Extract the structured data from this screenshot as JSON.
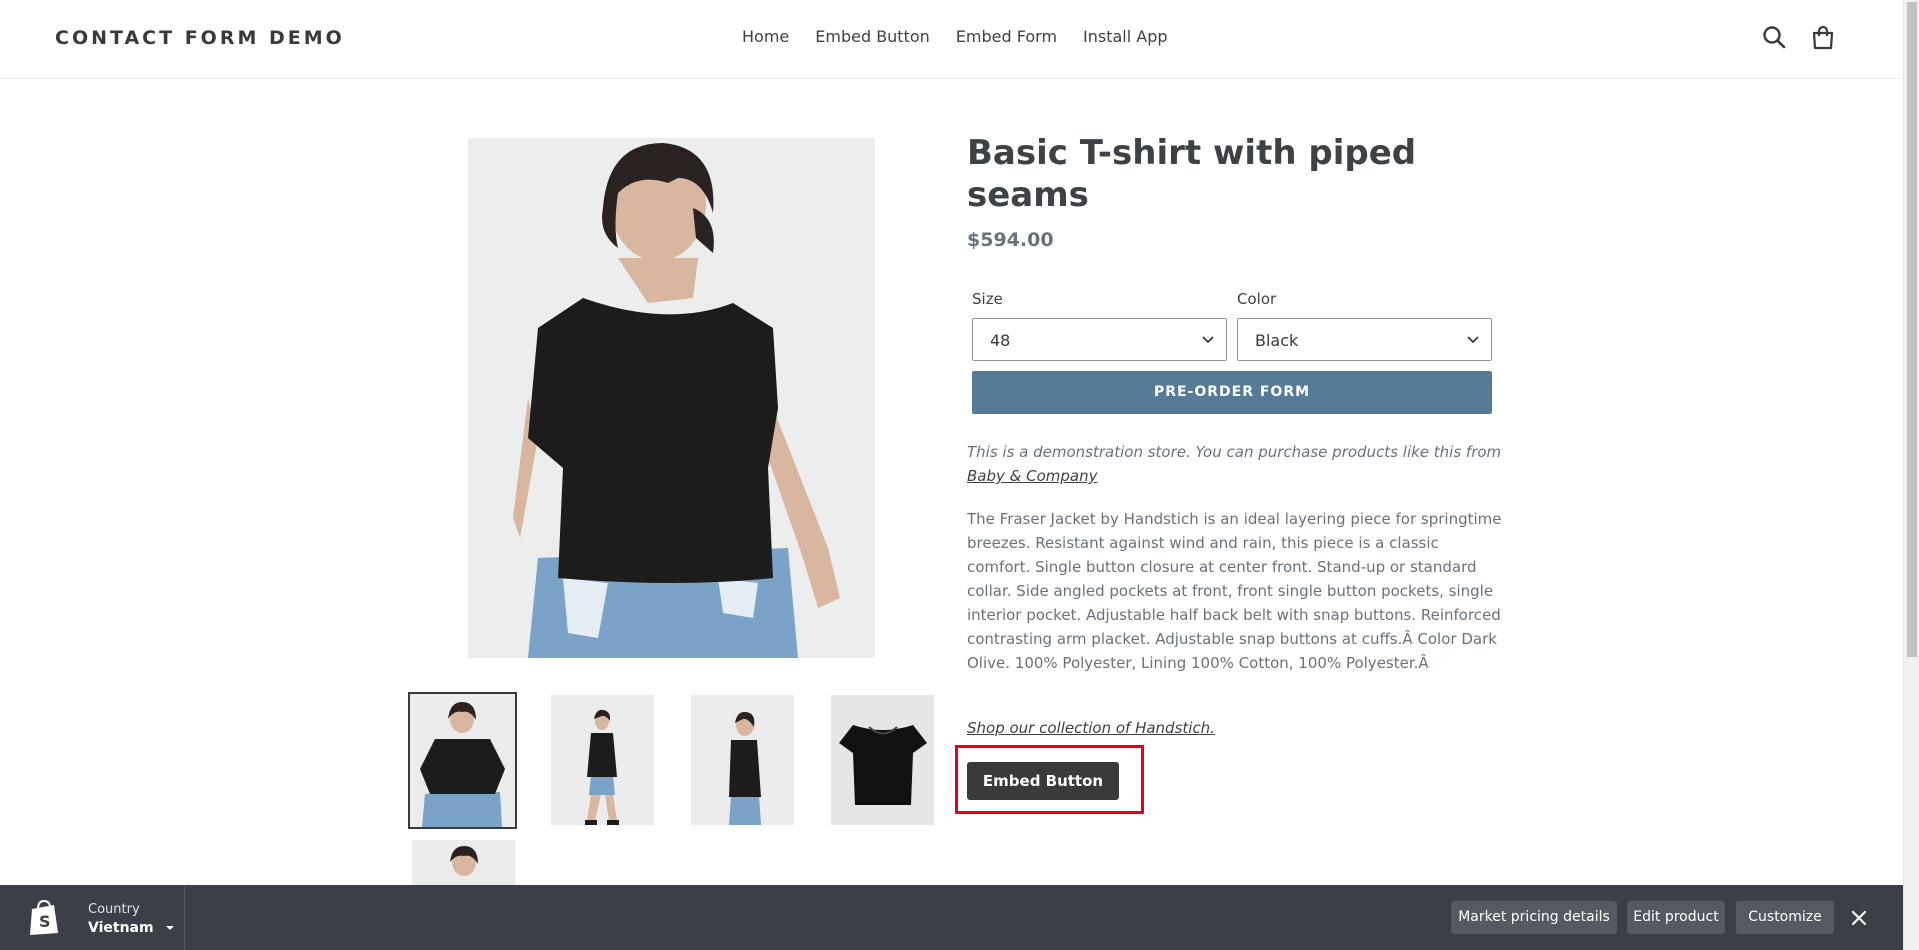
{
  "header": {
    "logo": "CONTACT FORM DEMO",
    "nav": [
      "Home",
      "Embed Button",
      "Embed Form",
      "Install App"
    ],
    "search_icon": "search-icon",
    "cart_icon": "cart-icon"
  },
  "product": {
    "title": "Basic T-shirt with piped seams",
    "price": "$594.00",
    "size_label": "Size",
    "size_value": "48",
    "color_label": "Color",
    "color_value": "Black",
    "preorder_label": "PRE-ORDER FORM",
    "demo_note": "This is a demonstration store. You can purchase products like this from",
    "demo_link": "Baby & Company",
    "description": "The Fraser Jacket by Handstich is an ideal layering piece for springtime breezes. Resistant against wind and rain, this piece is a classic comfort. Single button closure at center front. Stand-up or standard collar. Side angled pockets at front, front single button pockets, single interior pocket. Adjustable half back belt with snap buttons. Reinforced contrasting arm placket. Adjustable snap buttons at cuffs.Â Color Dark Olive. 100% Polyester, Lining 100% Cotton, 100% Polyester.Â",
    "shop_link": "Shop our collection of Handstich.",
    "embed_button": "Embed Button"
  },
  "admin_bar": {
    "country_label": "Country",
    "country_value": "Vietnam",
    "buttons": [
      "Market pricing details",
      "Edit product",
      "Customize"
    ]
  },
  "colors": {
    "accent": "#557b97",
    "highlight": "#e8001a",
    "admin_bg": "#3b3f47"
  }
}
